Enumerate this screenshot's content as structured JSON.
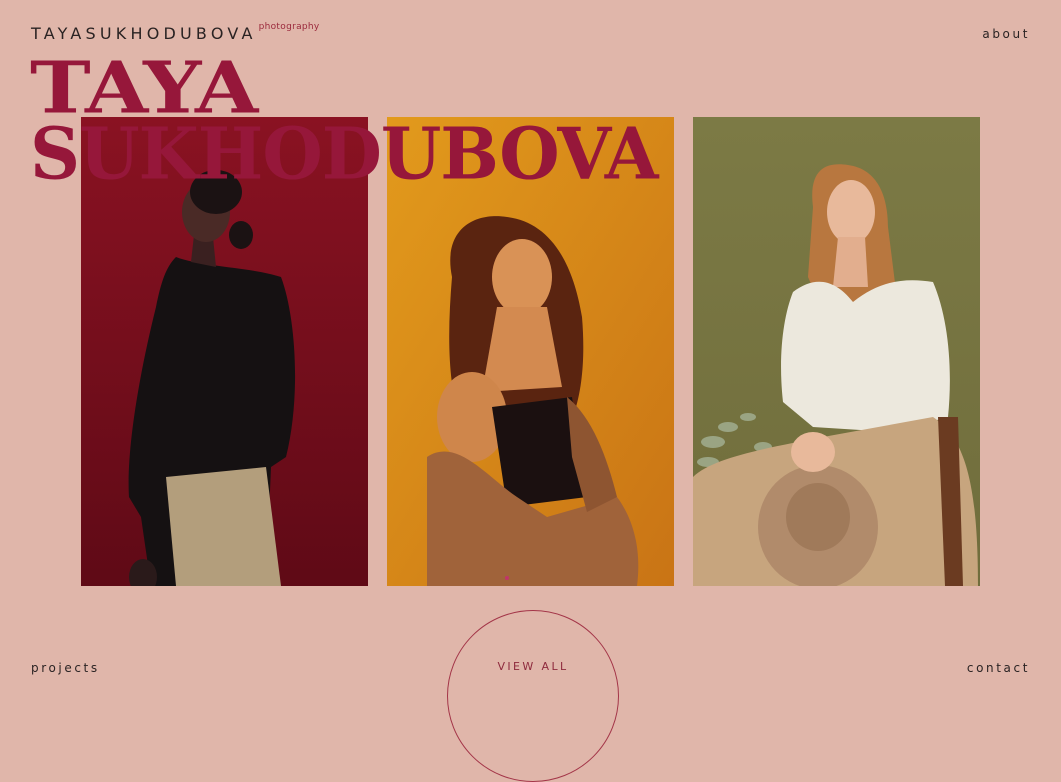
{
  "header": {
    "logo": "TAYASUKHODUBOVA",
    "logo_sub": "photography",
    "about_label": "about"
  },
  "hero": {
    "line1": "TAYA",
    "line2": "SUKHODUBOVA"
  },
  "gallery": {
    "photos": [
      {
        "name": "woman in black sweater on red background",
        "bg": "#7a0f1d"
      },
      {
        "name": "woman with eyes closed on orange background",
        "bg": "#d88a18"
      },
      {
        "name": "woman in white sweater holding hat on olive background",
        "bg": "#7d7842"
      }
    ]
  },
  "footer": {
    "projects_label": "projects",
    "view_all_label": "VIEW ALL",
    "contact_label": "contact"
  },
  "colors": {
    "background": "#e0b6aa",
    "accent": "#96173a",
    "text": "#2a2323"
  }
}
